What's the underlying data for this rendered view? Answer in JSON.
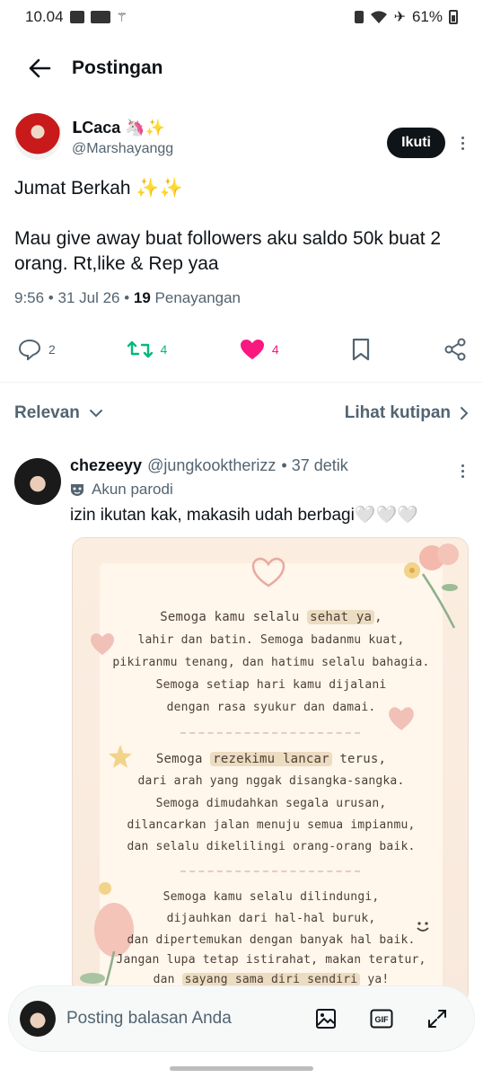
{
  "status_bar": {
    "time": "10.04",
    "battery": "61%"
  },
  "header": {
    "title": "Postingan"
  },
  "post": {
    "display_name": "ᒪCaca 🦄✨",
    "handle": "@Marshayangg",
    "follow_label": "Ikuti",
    "text": "Jumat Berkah ✨✨\n\nMau give away buat followers aku saldo 50k buat 2 orang. Rt,like & Rep yaa",
    "time": "9:56 • 31 Jul 26 • ",
    "views_count": "19",
    "views_label": " Penayangan",
    "replies": "2",
    "reposts": "4",
    "likes": "4"
  },
  "sort": {
    "left_label": "Relevan",
    "right_label": "Lihat kutipan"
  },
  "reply": {
    "display_name": "chezeeyy",
    "handle": "@jungkooktherizz",
    "time": "• 37 detik",
    "parody_label": "Akun parodi",
    "text": "izin ikutan kak, makasih udah berbagi🤍🤍🤍",
    "image_text": {
      "p1": [
        "Semoga kamu selalu ",
        "sehat ya",
        ",",
        "lahir dan batin. Semoga badanmu kuat,",
        "pikiranmu tenang, dan hatimu selalu bahagia.",
        "Semoga setiap hari kamu dijalani",
        "dengan rasa syukur dan damai."
      ],
      "p2": [
        "Semoga ",
        "rezekimu lancar",
        " terus,",
        "dari arah yang nggak disangka-sangka.",
        "Semoga dimudahkan segala urusan,",
        "dilancarkan jalan menuju semua impianmu,",
        "dan selalu dikelilingi orang-orang baik."
      ],
      "p3": [
        "Semoga kamu selalu dilindungi,",
        "dijauhkan dari hal-hal buruk,",
        "dan dipertemukan dengan banyak hal baik.",
        "Jangan lupa tetap istirahat, makan teratur,",
        "dan ",
        "sayang sama diri sendiri",
        " ya!"
      ]
    }
  },
  "composer": {
    "placeholder": "Posting balasan Anda"
  },
  "colors": {
    "accent": "#0f1419",
    "repost": "#00ba7c",
    "like": "#f91880",
    "muted": "#536471"
  }
}
